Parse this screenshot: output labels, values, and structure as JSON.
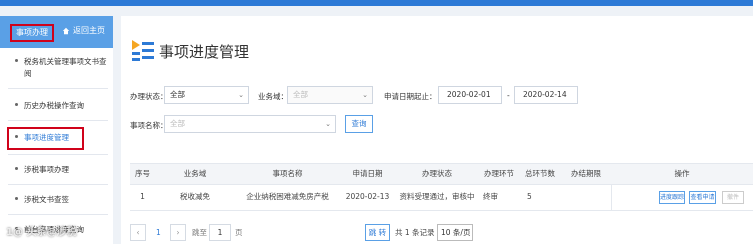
{
  "sidebar": {
    "title": "事项办理",
    "back": "返回主页",
    "items": [
      {
        "label": "税务机关管理事项文书查阅"
      },
      {
        "label": "历史办税操作查询"
      },
      {
        "label": "事项进度管理"
      },
      {
        "label": "涉税事项办理"
      },
      {
        "label": "涉税文书查签"
      },
      {
        "label": "前台事项进度查询"
      }
    ]
  },
  "page": {
    "title": "事项进度管理"
  },
  "filters": {
    "status_label": "办理状态：",
    "status_value": "全部",
    "business_label": "业务域：",
    "business_value": "全部",
    "date_label": "申请日期起止：",
    "date_from": "2020-02-01",
    "date_sep": "-",
    "date_to": "2020-02-14",
    "item_label": "事项名称：",
    "item_value": "全部",
    "query_button": "查询"
  },
  "table": {
    "headers": [
      "序号",
      "业务域",
      "事项名称",
      "申请日期",
      "办理状态",
      "办理环节",
      "总环节数",
      "办结期限",
      "操作"
    ],
    "rows": [
      {
        "index": "1",
        "domain": "税收减免",
        "item": "企业纳税困难减免房产税",
        "date": "2020-02-13",
        "status": "资料受理通过，审核中",
        "step": "终审",
        "total_steps": "5",
        "deadline": "",
        "actions": [
          "进度跟踪",
          "查看申请",
          "撤件"
        ]
      }
    ]
  },
  "pagination": {
    "prev": "‹",
    "current_page": "1",
    "next": "›",
    "goto_prefix": "跳至",
    "goto_value": "1",
    "goto_suffix": "页",
    "goto_button": "跳 转",
    "total": "共 1 条记录",
    "page_size": "10 条/页"
  },
  "watermark": "1@ 头条@涉税"
}
